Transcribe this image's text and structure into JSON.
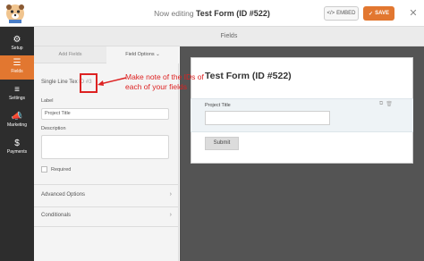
{
  "header": {
    "editing_prefix": "Now editing",
    "form_name": "Test Form (ID #522)",
    "embed_label": "EMBED",
    "embed_icon": "code-icon",
    "save_label": "SAVE",
    "save_icon": "check-icon",
    "close_icon": "close-icon",
    "logo_icon": "wpforms-bear-logo"
  },
  "sidebar": {
    "items": [
      {
        "label": "Setup",
        "icon": "gear-icon"
      },
      {
        "label": "Fields",
        "icon": "list-icon"
      },
      {
        "label": "Settings",
        "icon": "sliders-icon"
      },
      {
        "label": "Marketing",
        "icon": "megaphone-icon"
      },
      {
        "label": "Payments",
        "icon": "dollar-icon"
      }
    ]
  },
  "fields_bar": {
    "title": "Fields"
  },
  "panel": {
    "tab_add": "Add Fields",
    "tab_options": "Field Options",
    "field_type": "Single Line Tex",
    "field_id": "ID #3",
    "label_caption": "Label",
    "label_value": "Project Title",
    "description_caption": "Description",
    "required_label": "Required",
    "advanced_options": "Advanced Options",
    "conditionals": "Conditionals"
  },
  "annotation": {
    "text": "Make note of the IDs of each of your fields"
  },
  "preview": {
    "form_title": "Test Form (ID #522)",
    "field_label": "Project Title",
    "submit_label": "Submit"
  },
  "colors": {
    "accent": "#e27730",
    "sidebar_bg": "#2d2d2d",
    "annotation_red": "#dd2222",
    "preview_bg": "#545454"
  }
}
